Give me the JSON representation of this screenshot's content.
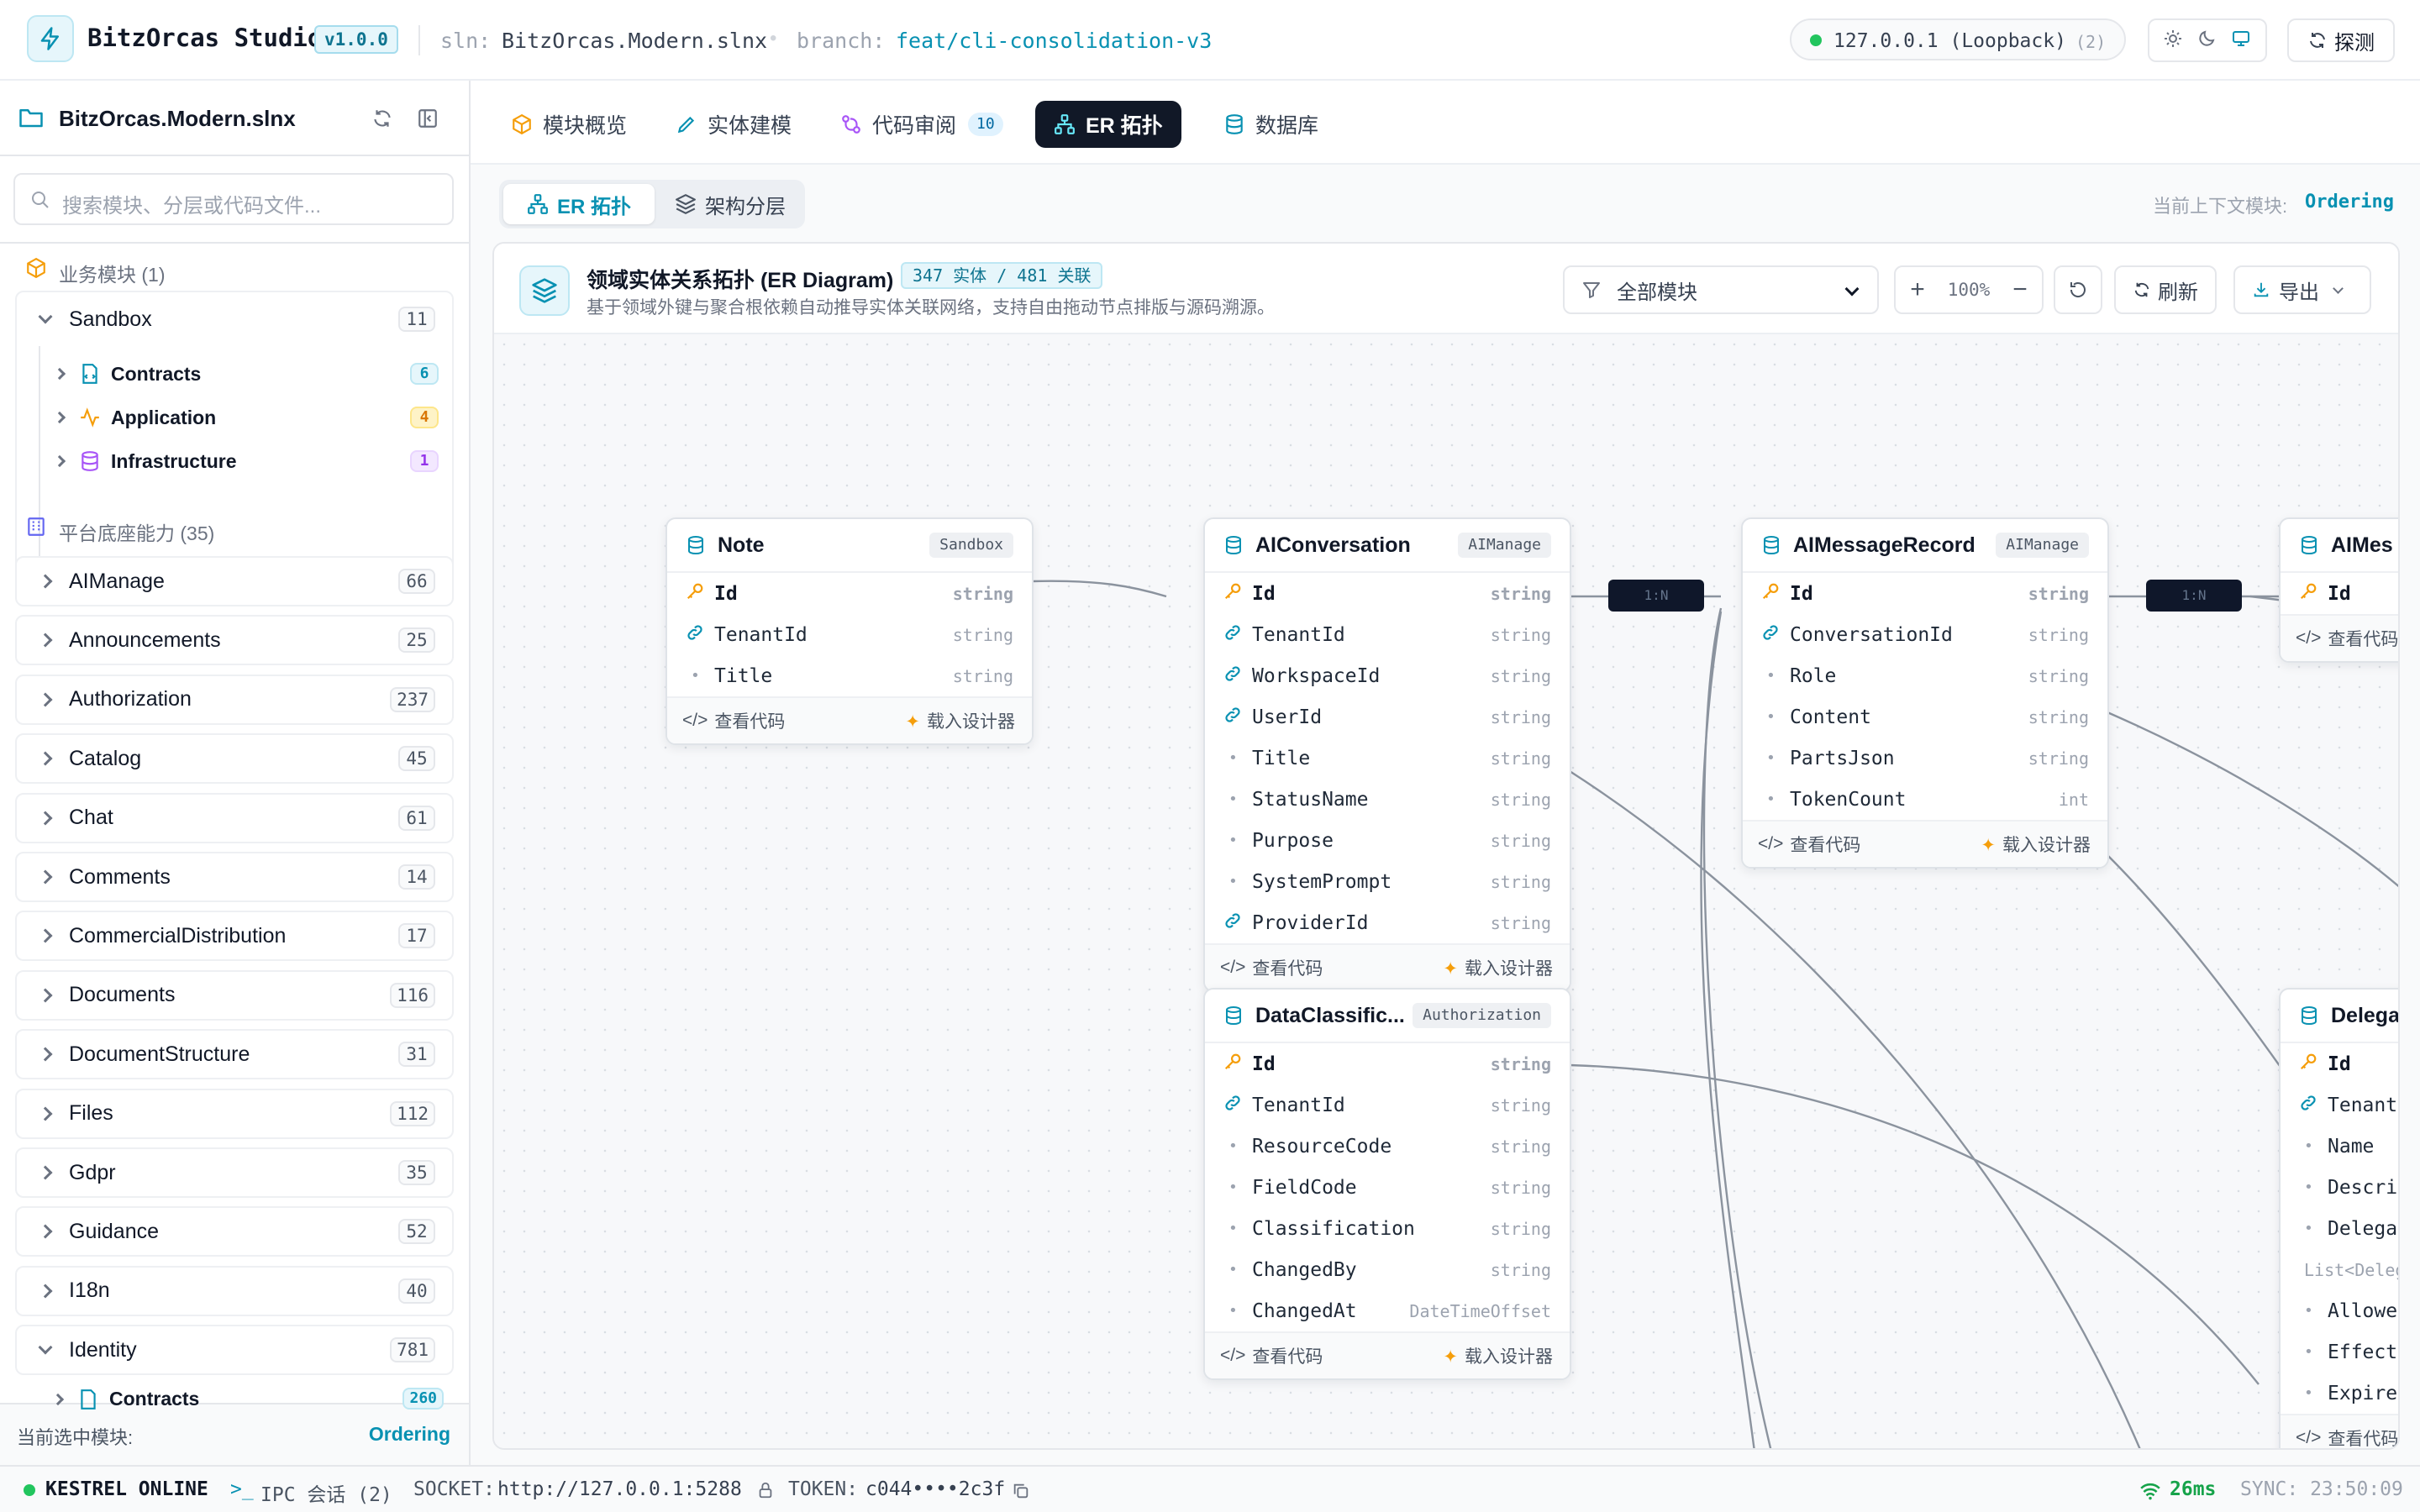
{
  "app": {
    "name": "BitzOrcas Studio",
    "version": "v1.0.0",
    "sln_label": "sln:",
    "sln_value": "BitzOrcas.Modern.slnx",
    "branch_label": "branch:",
    "branch_value": "feat/cli-consolidation-v3",
    "host": "127.0.0.1 (Loopback)",
    "host_count": "(2)",
    "probe_label": "探测"
  },
  "sidebar": {
    "solution": "BitzOrcas.Modern.slnx",
    "search_placeholder": "搜索模块、分层或代码文件...",
    "business_section": "业务模块 (1)",
    "sandbox": {
      "label": "Sandbox",
      "count": "11",
      "children": [
        {
          "label": "Contracts",
          "count": "6"
        },
        {
          "label": "Application",
          "count": "4"
        },
        {
          "label": "Infrastructure",
          "count": "1"
        }
      ]
    },
    "platform_section": "平台底座能力 (35)",
    "modules": [
      {
        "label": "AIManage",
        "count": "66"
      },
      {
        "label": "Announcements",
        "count": "25"
      },
      {
        "label": "Authorization",
        "count": "237"
      },
      {
        "label": "Catalog",
        "count": "45"
      },
      {
        "label": "Chat",
        "count": "61"
      },
      {
        "label": "Comments",
        "count": "14"
      },
      {
        "label": "CommercialDistribution",
        "count": "17"
      },
      {
        "label": "Documents",
        "count": "116"
      },
      {
        "label": "DocumentStructure",
        "count": "31"
      },
      {
        "label": "Files",
        "count": "112"
      },
      {
        "label": "Gdpr",
        "count": "35"
      },
      {
        "label": "Guidance",
        "count": "52"
      },
      {
        "label": "I18n",
        "count": "40"
      },
      {
        "label": "Identity",
        "count": "781"
      }
    ],
    "identity_child": {
      "label": "Contracts",
      "count": "260"
    },
    "footer_label": "当前选中模块:",
    "footer_value": "Ordering"
  },
  "tabs": [
    {
      "label": "模块概览"
    },
    {
      "label": "实体建模"
    },
    {
      "label": "代码审阅",
      "badge": "10"
    },
    {
      "label": "ER 拓扑"
    },
    {
      "label": "数据库"
    }
  ],
  "subtabs": [
    {
      "label": "ER 拓扑"
    },
    {
      "label": "架构分层"
    }
  ],
  "context": {
    "label": "当前上下文模块:",
    "value": "Ordering"
  },
  "diagram": {
    "title": "领域实体关系拓扑 (ER Diagram)",
    "stats": "347 实体 / 481 关联",
    "subtitle": "基于领域外键与聚合根依赖自动推导实体关联网络，支持自由拖动节点排版与源码溯源。",
    "filter": "全部模块",
    "zoom": "100%",
    "refresh": "刷新",
    "export": "导出",
    "view_code": "查看代码",
    "load_designer": "载入设计器",
    "edge_label": "1:N"
  },
  "entities": {
    "note": {
      "name": "Note",
      "module": "Sandbox",
      "fields": [
        [
          "Id",
          "string"
        ],
        [
          "TenantId",
          "string"
        ],
        [
          "Title",
          "string"
        ]
      ]
    },
    "aiconv": {
      "name": "AIConversation",
      "module": "AIManage",
      "fields": [
        [
          "Id",
          "string"
        ],
        [
          "TenantId",
          "string"
        ],
        [
          "WorkspaceId",
          "string"
        ],
        [
          "UserId",
          "string"
        ],
        [
          "Title",
          "string"
        ],
        [
          "StatusName",
          "string"
        ],
        [
          "Purpose",
          "string"
        ],
        [
          "SystemPrompt",
          "string"
        ],
        [
          "ProviderId",
          "string"
        ]
      ]
    },
    "aimsg": {
      "name": "AIMessageRecord",
      "module": "AIManage",
      "fields": [
        [
          "Id",
          "string"
        ],
        [
          "ConversationId",
          "string"
        ],
        [
          "Role",
          "string"
        ],
        [
          "Content",
          "string"
        ],
        [
          "PartsJson",
          "string"
        ],
        [
          "TokenCount",
          "int"
        ]
      ]
    },
    "aimes": {
      "name": "AIMes",
      "fields": [
        [
          "Id",
          ""
        ]
      ]
    },
    "dataclass": {
      "name": "DataClassific...",
      "module": "Authorization",
      "fields": [
        [
          "Id",
          "string"
        ],
        [
          "TenantId",
          "string"
        ],
        [
          "ResourceCode",
          "string"
        ],
        [
          "FieldCode",
          "string"
        ],
        [
          "Classification",
          "string"
        ],
        [
          "ChangedBy",
          "string"
        ],
        [
          "ChangedAt",
          "DateTimeOffset"
        ]
      ]
    },
    "delega": {
      "name": "Delega",
      "fields": [
        "Id",
        "TenantI",
        "Name",
        "Descrip",
        "Delegat",
        "List<Deleg",
        "Allowed",
        "Effect",
        "Expire"
      ]
    }
  },
  "statusbar": {
    "kestrel": "KESTREL ONLINE",
    "ipc": "IPC 会话 (2)",
    "socket_label": "SOCKET:",
    "socket": "http://127.0.0.1:5288",
    "token_label": "TOKEN:",
    "token": "c044••••2c3f",
    "latency": "26ms",
    "sync": "SYNC: 23:50:09"
  },
  "colors": {
    "accent": "#0891b2",
    "dark": "#0f172a",
    "key": "#f59e0b"
  }
}
